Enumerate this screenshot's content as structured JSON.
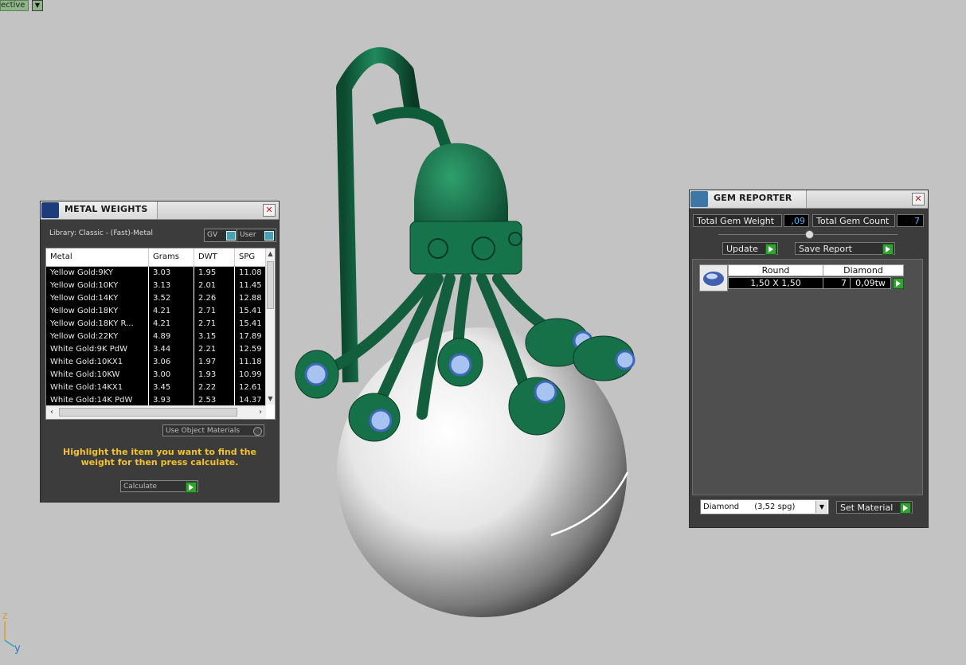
{
  "viewport": {
    "view_label": "ective",
    "axis_z": "z",
    "axis_y": "y"
  },
  "metal_weights": {
    "title": "METAL WEIGHTS",
    "library": "Library: Classic - (Fast)-Metal",
    "toggle_gv": "GV",
    "toggle_user": "User",
    "columns": [
      "Metal",
      "Grams",
      "DWT",
      "SPG"
    ],
    "rows": [
      [
        "Yellow Gold:9KY",
        "3.03",
        "1.95",
        "11.08"
      ],
      [
        "Yellow Gold:10KY",
        "3.13",
        "2.01",
        "11.45"
      ],
      [
        "Yellow Gold:14KY",
        "3.52",
        "2.26",
        "12.88"
      ],
      [
        "Yellow Gold:18KY",
        "4.21",
        "2.71",
        "15.41"
      ],
      [
        "Yellow Gold:18KY R...",
        "4.21",
        "2.71",
        "15.41"
      ],
      [
        "Yellow Gold:22KY",
        "4.89",
        "3.15",
        "17.89"
      ],
      [
        "White Gold:9K PdW",
        "3.44",
        "2.21",
        "12.59"
      ],
      [
        "White Gold:10KX1",
        "3.06",
        "1.97",
        "11.18"
      ],
      [
        "White Gold:10KW",
        "3.00",
        "1.93",
        "10.99"
      ],
      [
        "White Gold:14KX1",
        "3.45",
        "2.22",
        "12.61"
      ],
      [
        "White Gold:14K PdW",
        "3.93",
        "2.53",
        "14.37"
      ]
    ],
    "use_object_materials": "Use Object Materials",
    "hint": "Highlight the item you want to find the weight for then press calculate.",
    "calculate": "Calculate"
  },
  "gem_reporter": {
    "title": "GEM REPORTER",
    "total_weight_label": "Total Gem Weight",
    "total_weight_value": ",09",
    "total_count_label": "Total Gem Count",
    "total_count_value": "7",
    "update": "Update",
    "save_report": "Save Report",
    "gem_shape": "Round",
    "gem_material": "Diamond",
    "gem_size": "1,50 X 1,50",
    "gem_count": "7",
    "gem_total": "0,09tw",
    "material_select": "Diamond      (3,52 spg)",
    "set_material": "Set Material"
  }
}
